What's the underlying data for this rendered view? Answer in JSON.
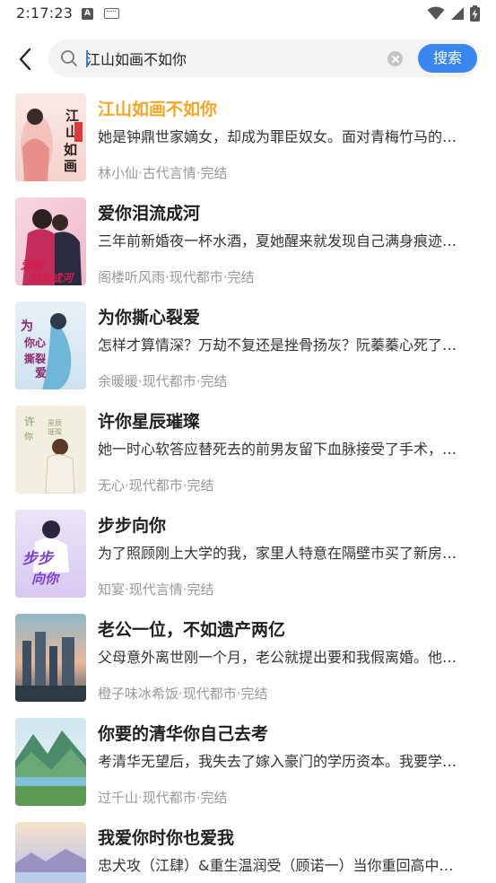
{
  "status_bar": {
    "time": "2:17:23"
  },
  "search": {
    "query": "江山如画不如你",
    "button_label": "搜索"
  },
  "books": [
    {
      "title": "江山如画不如你",
      "description": "她是钟鼎世家嫡女，却成为罪臣奴女。面对青梅竹马的…",
      "author": "林小仙",
      "category": "古代言情",
      "status": "完结",
      "meta": "林小仙·古代言情·完结",
      "cover_text": "江山如画",
      "highlight": true
    },
    {
      "title": "爱你泪流成河",
      "description": "三年前新婚夜一杯水酒，夏她醒来就发现自己满身痕迹…",
      "author": "阁楼听风雨",
      "category": "现代都市",
      "status": "完结",
      "meta": "阁楼听风雨·现代都市·完结",
      "cover_text": "爱你泪流成河"
    },
    {
      "title": "为你撕心裂爱",
      "description": "怎样才算情深？万劫不复还是挫骨扬灰？阮蓁蓁心死了…",
      "author": "余暖暖",
      "category": "现代都市",
      "status": "完结",
      "meta": "余暖暖·现代都市·完结",
      "cover_text": "为你撕心裂爱"
    },
    {
      "title": "许你星辰璀璨",
      "description": "她一时心软答应替死去的前男友留下血脉接受了手术，…",
      "author": "无心",
      "category": "现代都市",
      "status": "完结",
      "meta": "无心·现代都市·完结",
      "cover_text": "许你星辰璀璨"
    },
    {
      "title": "步步向你",
      "description": "为了照顾刚上大学的我，家里人特意在隔壁市买了新房…",
      "author": "知宴",
      "category": "现代言情",
      "status": "完结",
      "meta": "知宴·现代言情·完结",
      "cover_text": "步步向你"
    },
    {
      "title": "老公一位，不如遗产两亿",
      "description": "父母意外离世刚一个月，老公就提出要和我假离婚。他…",
      "author": "橙子味冰希饭",
      "category": "现代都市",
      "status": "完结",
      "meta": "橙子味冰希饭·现代都市·完结",
      "cover_text": ""
    },
    {
      "title": "你要的清华你自己去考",
      "description": "考清华无望后，我失去了嫁入豪门的学历资本。我要学…",
      "author": "过千山",
      "category": "现代都市",
      "status": "完结",
      "meta": "过千山·现代都市·完结",
      "cover_text": ""
    },
    {
      "title": "我爱你时你也爱我",
      "description": "忠犬攻（江肆）&重生温润受（顾诺一）当你重回高中…",
      "author": "",
      "category": "",
      "status": "",
      "meta": "",
      "cover_text": ""
    }
  ],
  "colors": {
    "accent": "#3a87f2",
    "highlight": "#f5a623",
    "meta_text": "#999999"
  },
  "icons": {
    "back": "chevron-left-icon",
    "search": "search-icon",
    "clear": "clear-icon",
    "wifi": "wifi-icon",
    "signal": "signal-icon",
    "battery": "battery-charging-icon"
  }
}
